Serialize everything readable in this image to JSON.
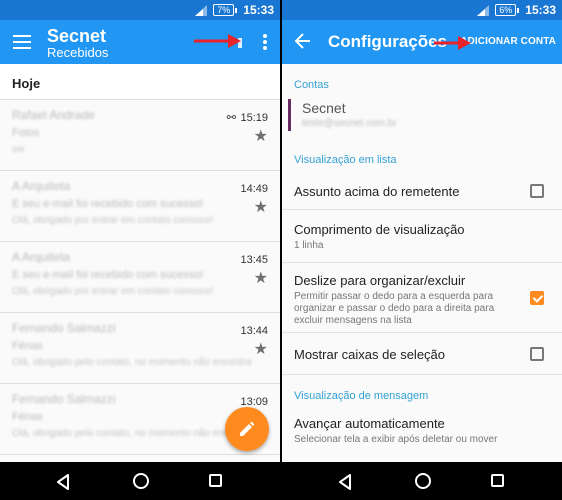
{
  "status": {
    "battery_left": "7%",
    "battery_right": "6%",
    "time": "15:33"
  },
  "inbox": {
    "title": "Secnet",
    "subtitle": "Recebidos",
    "section": "Hoje",
    "messages": [
      {
        "sender": "Rafael Andrade",
        "subject": "Fotos",
        "preview": "sw",
        "time": "15:19",
        "attachment": true
      },
      {
        "sender": "A Arquiteta",
        "subject": "E seu e-mail foi recebido com sucesso!",
        "preview": "Olá, obrigado por entrar em contato conosco!",
        "time": "14:49"
      },
      {
        "sender": "A Arquiteta",
        "subject": "E seu e-mail foi recebido com sucesso!",
        "preview": "Olá, obrigado por entrar em contato conosco!",
        "time": "13:45"
      },
      {
        "sender": "Fernando Salmazzi",
        "subject": "Fénas",
        "preview": "Olá, obrigado pelo contato, no momento não encontramos",
        "time": "13:44"
      },
      {
        "sender": "Fernando Salmazzi",
        "subject": "Fénas",
        "preview": "Olá, obrigado pelo contato, no momento não encontramos",
        "time": "13:09"
      }
    ]
  },
  "settings": {
    "title": "Configurações",
    "add_account": "ADICIONAR CONTA",
    "accounts_header": "Contas",
    "account_name": "Secnet",
    "account_email": "teste@secnet.com.br",
    "list_header": "Visualização em lista",
    "subject_above": "Assunto acima do remetente",
    "preview_length": "Comprimento de visualização",
    "preview_length_value": "1 linha",
    "swipe_title": "Deslize para organizar/excluir",
    "swipe_desc": "Permitir passar o dedo para a esquerda para organizar e passar o dedo para a direita para excluir mensagens na lista",
    "show_checkboxes": "Mostrar caixas de seleção",
    "message_header": "Visualização de mensagem",
    "auto_advance": "Avançar automaticamente",
    "auto_advance_desc": "Selecionar tela a exibir após deletar ou mover"
  },
  "colors": {
    "primary": "#2196f3",
    "status": "#1976d2",
    "accent": "#ff8a1d",
    "arrow": "#e8232a"
  }
}
